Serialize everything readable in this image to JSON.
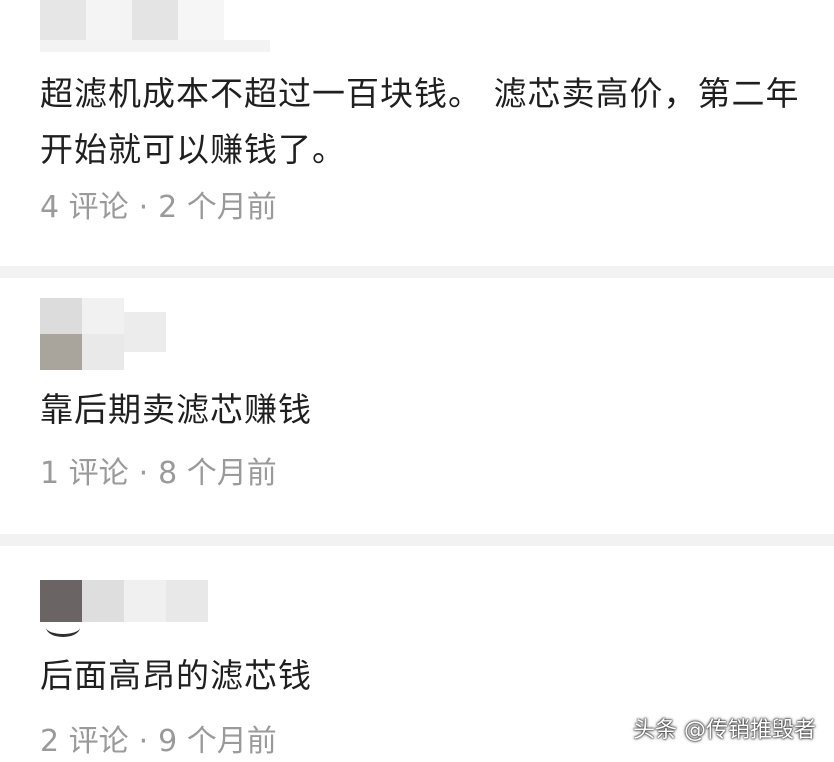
{
  "comments": [
    {
      "text": "超滤机成本不超过一百块钱。 滤芯卖高价，第二年开始就可以赚钱了。",
      "reply_count": "4 评论",
      "separator": "·",
      "time": "2 个月前"
    },
    {
      "text": "靠后期卖滤芯赚钱",
      "reply_count": "1 评论",
      "separator": "·",
      "time": "8 个月前"
    },
    {
      "text": "后面高昂的滤芯钱",
      "reply_count": "2 评论",
      "separator": "·",
      "time": "9 个月前"
    }
  ],
  "watermark": {
    "text": "头条 @传销推毁者"
  },
  "colors": {
    "divider": "#f2f2f2",
    "meta_text": "#9a9a9a",
    "body_text": "#1f1f1f"
  }
}
